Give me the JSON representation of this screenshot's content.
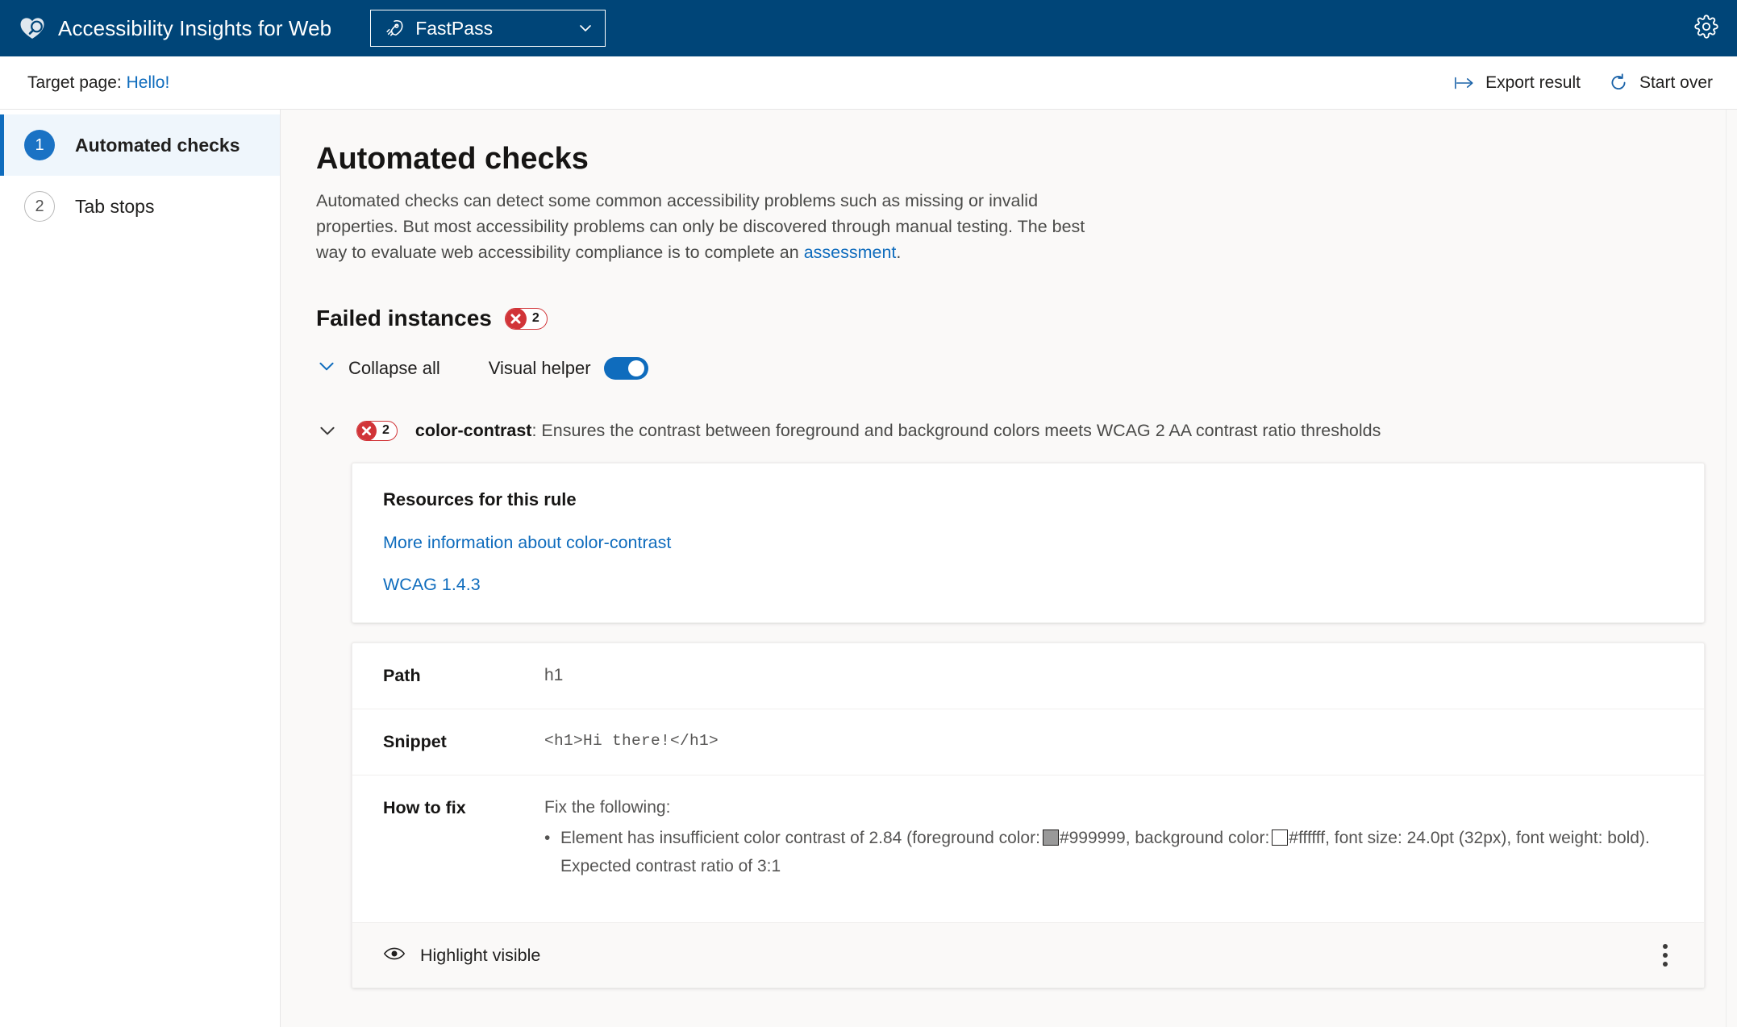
{
  "header": {
    "logo_icon": "heart-magnifier-logo",
    "app_title": "Accessibility Insights for Web",
    "mode_selector": {
      "icon": "rocket-icon",
      "value": "FastPass",
      "chevron": "chevron-down-icon"
    },
    "settings_icon": "gear-icon",
    "brand_color": "#004578"
  },
  "target_bar": {
    "label": "Target page:",
    "page_name": "Hello!",
    "actions": [
      {
        "icon": "export-arrow-icon",
        "label": "Export result"
      },
      {
        "icon": "refresh-circle-icon",
        "label": "Start over"
      }
    ]
  },
  "sidebar": {
    "items": [
      {
        "number": "1",
        "label": "Automated checks",
        "selected": true
      },
      {
        "number": "2",
        "label": "Tab stops",
        "selected": false
      }
    ]
  },
  "main": {
    "title": "Automated checks",
    "description_part1": "Automated checks can detect some common accessibility problems such as missing or invalid properties. But most accessibility problems can only be discovered through manual testing. The best way to evaluate web accessibility compliance is to complete an ",
    "description_link": "assessment",
    "description_part2": ".",
    "failed_instances": {
      "title": "Failed instances",
      "count": "2",
      "badge_color": "#d13438"
    },
    "controls": {
      "collapse_all": "Collapse all",
      "visual_helper_label": "Visual helper",
      "visual_helper_on": true,
      "toggle_color": "#0f6cbd"
    },
    "rule": {
      "count": "2",
      "name": "color-contrast",
      "separator": ": ",
      "description": "Ensures the contrast between foreground and background colors meets WCAG 2 AA contrast ratio thresholds"
    },
    "resources_card": {
      "title": "Resources for this rule",
      "links": [
        "More information about color-contrast",
        "WCAG 1.4.3"
      ]
    },
    "details_card": {
      "rows": [
        {
          "label": "Path",
          "value": "h1",
          "mono": false
        },
        {
          "label": "Snippet",
          "value": "<h1>Hi there!</h1>",
          "mono": true
        }
      ],
      "how_to_fix": {
        "label": "How to fix",
        "intro": "Fix the following:",
        "item_part1": "Element has insufficient color contrast of 2.84 (foreground color:",
        "foreground_swatch": "#999999",
        "foreground_text": "#999999, background color:",
        "background_swatch": "#ffffff",
        "background_text": "#ffffff, font size: 24.0pt (32px), font weight: bold). Expected contrast ratio of 3:1"
      },
      "footer": {
        "eye_icon": "eye-icon",
        "highlight_label": "Highlight visible",
        "more_icon": "more-vertical-icon"
      }
    }
  }
}
